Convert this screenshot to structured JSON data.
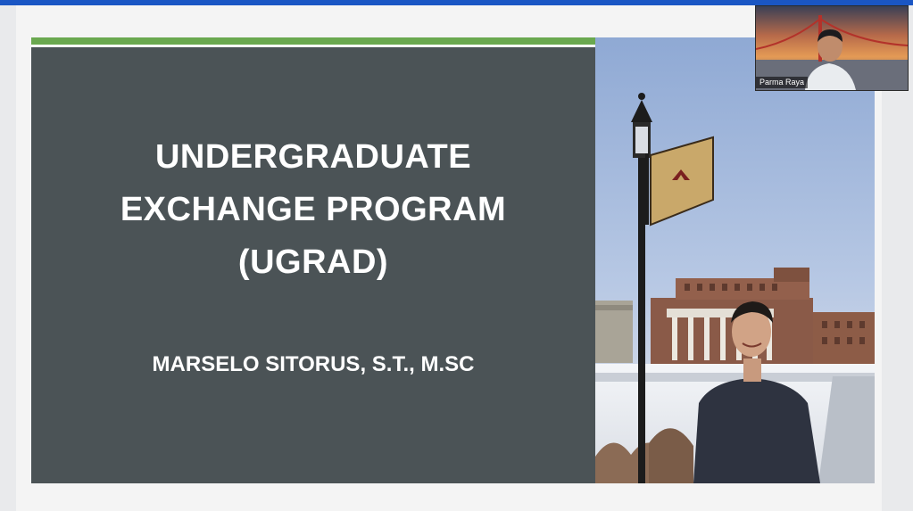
{
  "slide": {
    "title_lines": [
      "UNDERGRADUATE",
      "EXCHANGE PROGRAM",
      "(UGRAD)"
    ],
    "presenter": "MARSELO SITORUS, S.T., M.SC",
    "photo_alt": "",
    "colors": {
      "panel": "#4b5356",
      "accent": "#6aa84f",
      "text": "#ffffff"
    }
  },
  "meeting": {
    "participant_name": "Parma Raya",
    "topbar_color": "#1a56c4"
  }
}
